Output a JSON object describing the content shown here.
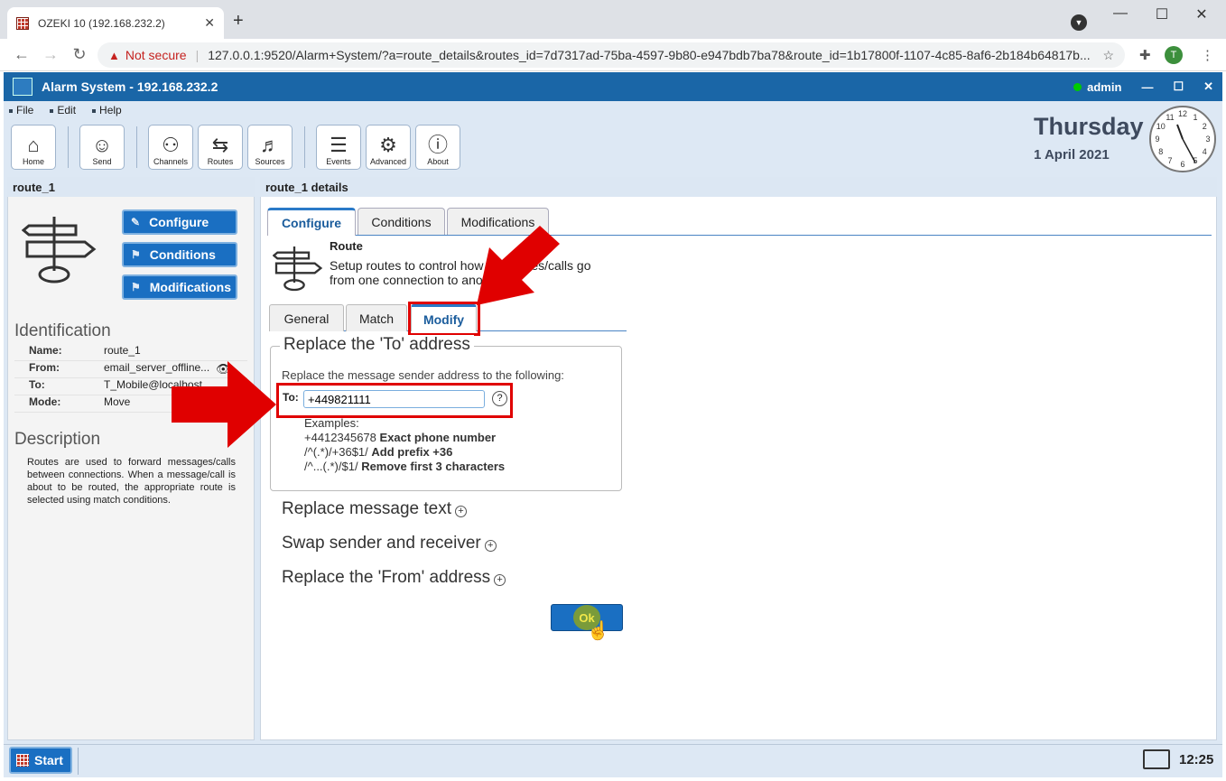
{
  "browser": {
    "tab_title": "OZEKI 10 (192.168.232.2)",
    "security_label": "Not secure",
    "url": "127.0.0.1:9520/Alarm+System/?a=route_details&routes_id=7d7317ad-75ba-4597-9b80-e947bdb7ba78&route_id=1b17800f-1107-4c85-8af6-2b184b64817b...",
    "profile_initial": "T"
  },
  "app": {
    "title": "Alarm System - 192.168.232.2",
    "user": "admin",
    "menu": [
      "File",
      "Edit",
      "Help"
    ],
    "toolbar": [
      {
        "label": "Home",
        "icon": "home-icon"
      },
      {
        "label": "Send",
        "icon": "send-icon"
      },
      {
        "label": "Channels",
        "icon": "channels-icon"
      },
      {
        "label": "Routes",
        "icon": "routes-icon"
      },
      {
        "label": "Sources",
        "icon": "sources-icon"
      },
      {
        "label": "Events",
        "icon": "events-icon"
      },
      {
        "label": "Advanced",
        "icon": "gear-icon"
      },
      {
        "label": "About",
        "icon": "info-icon"
      }
    ],
    "day": "Thursday",
    "date": "1 April 2021",
    "clock_numbers": [
      "12",
      "1",
      "2",
      "3",
      "4",
      "5",
      "6",
      "7",
      "8",
      "9",
      "10",
      "11"
    ]
  },
  "left": {
    "header": "route_1",
    "buttons": [
      "Configure",
      "Conditions",
      "Modifications"
    ],
    "identification_title": "Identification",
    "identification": [
      {
        "key": "Name:",
        "value": "route_1"
      },
      {
        "key": "From:",
        "value": "email_server_offline..."
      },
      {
        "key": "To:",
        "value": "T_Mobile@localhost"
      },
      {
        "key": "Mode:",
        "value": "Move"
      }
    ],
    "description_title": "Description",
    "description": "Routes are used to forward messages/calls between connections. When a message/call is about to be routed, the appropriate route is selected using match conditions."
  },
  "right": {
    "header": "route_1 details",
    "tabs": [
      "Configure",
      "Conditions",
      "Modifications"
    ],
    "route_title": "Route",
    "route_desc": "Setup routes to control how messages/calls go from one connection to another.",
    "subtabs": [
      "General",
      "Match",
      "Modify"
    ],
    "section_title": "Replace the 'To' address",
    "section_desc": "Replace the message sender address to the following:",
    "to_label": "To:",
    "to_value": "+449821111",
    "help": "?",
    "examples_title": "Examples:",
    "examples": [
      {
        "code": "+4412345678",
        "desc": "Exact phone number"
      },
      {
        "code": "/^(.*)/+36$1/",
        "desc": "Add prefix +36"
      },
      {
        "code": "/^...(.*)/$1/",
        "desc": "Remove first 3 characters"
      }
    ],
    "expanders": [
      "Replace message text",
      "Swap sender and receiver",
      "Replace the 'From' address"
    ],
    "ok": "Ok"
  },
  "taskbar": {
    "start": "Start",
    "time": "12:25"
  },
  "colors": {
    "accent": "#1a6fc2",
    "titlebar": "#1a66a7",
    "highlight": "#e00000"
  }
}
